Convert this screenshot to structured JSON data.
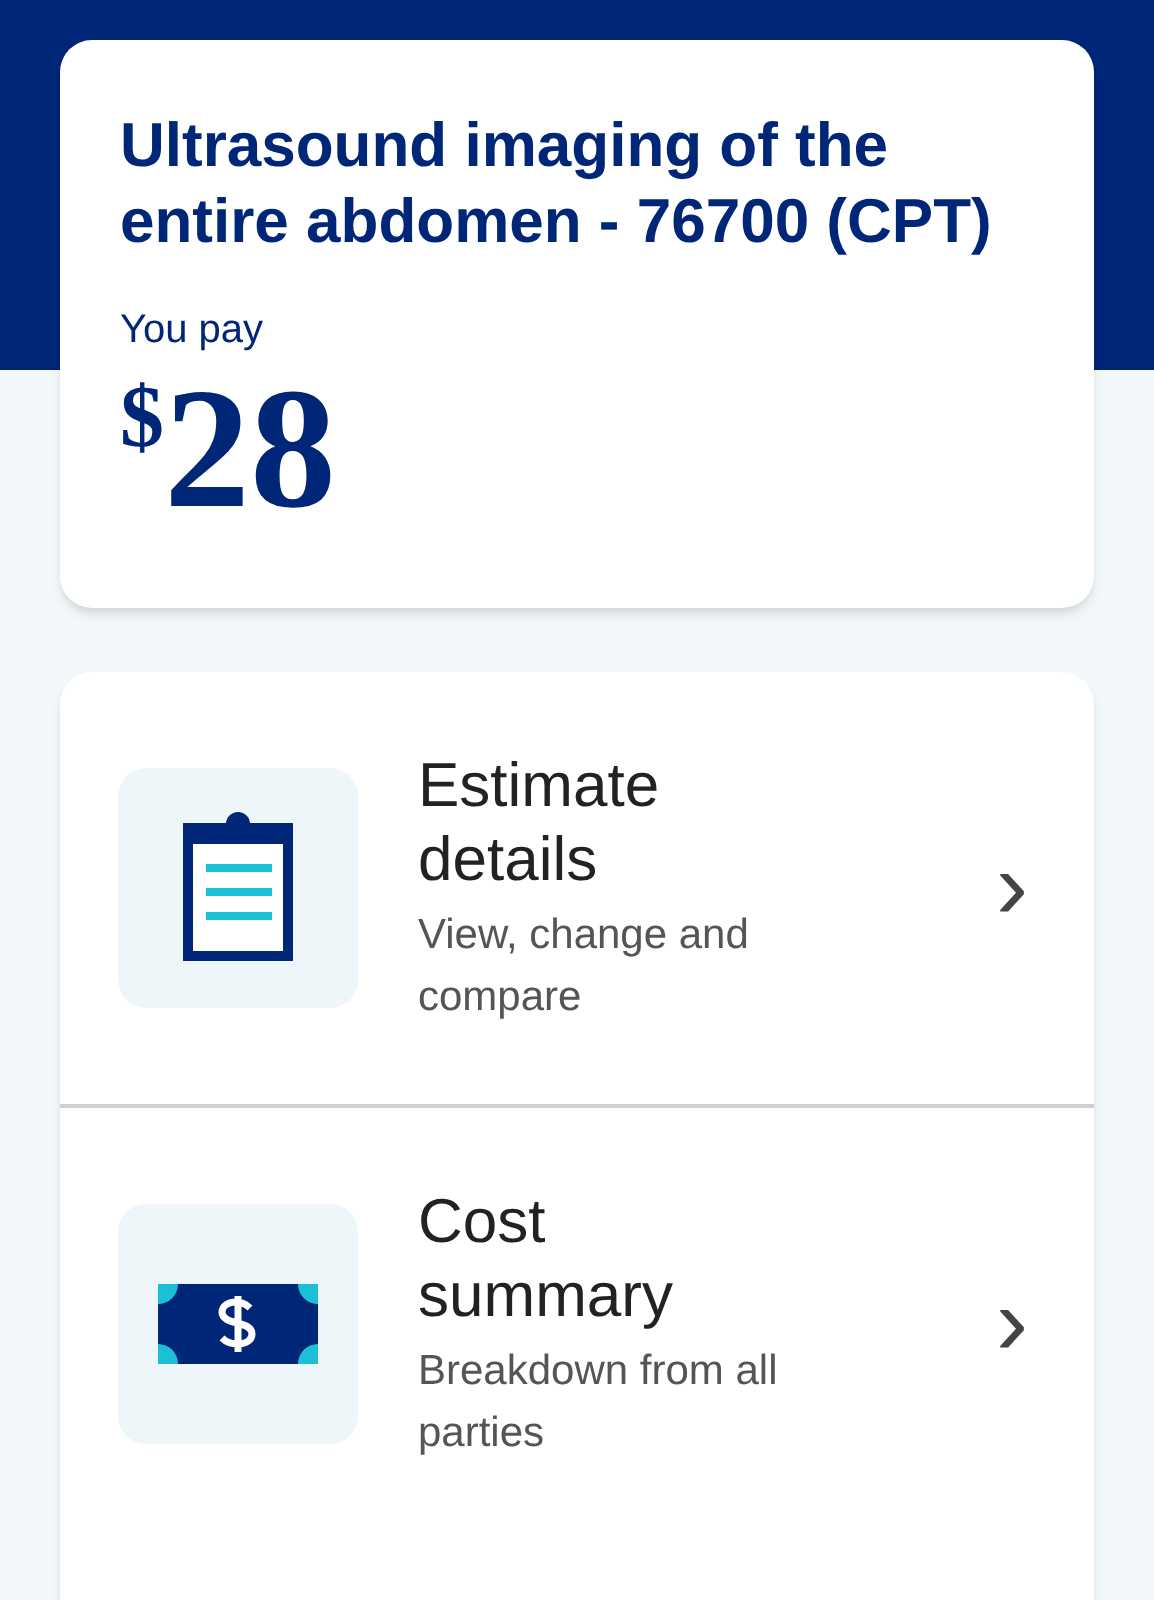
{
  "summary": {
    "title": "Ultrasound imaging of the entire abdomen - 76700 (CPT)",
    "pay_label": "You pay",
    "currency": "$",
    "amount": "28"
  },
  "items": [
    {
      "kind": "clipboard",
      "title": "Estimate details",
      "subtitle": "View, change and compare",
      "chevron": "›"
    },
    {
      "kind": "money",
      "title": "Cost summary",
      "subtitle": "Breakdown from all parties",
      "chevron": "›"
    }
  ]
}
